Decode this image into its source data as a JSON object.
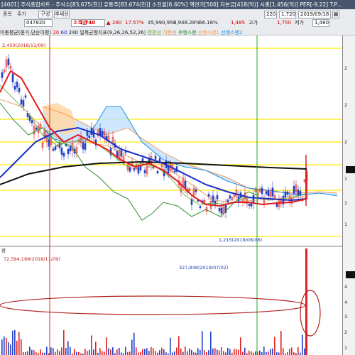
{
  "window": {
    "title": "[4001] 주식종합차트 - 주식수[83,675(천)] 유통주[83,674(천)] 소진율[6.60%] 액면가[500] 자본금[418(억)] 시총[1,456(억)] PER[-9.22] T.P..."
  },
  "toolbar": {
    "tabs": [
      "종목",
      "주기"
    ],
    "code_value": "047820",
    "buttons": [
      "구성",
      "추세선"
    ],
    "stock_name": "초록뱀",
    "price": "1,740",
    "price_arrow": "▲",
    "change": "260",
    "change_pct": "17.57%",
    "volume": "45,990,958",
    "amount": "3,948.28%",
    "ratio": "56.16%",
    "high_value": "1,485",
    "high_label": "고가",
    "prev_label": "저가",
    "prev_value": "1,750",
    "period_count": "220",
    "date_from": "1,720",
    "date_to": "2019/09/18",
    "qty": "1,480"
  },
  "legend": {
    "ma_label": "이동평균(종가,단순이평)",
    "ma_periods": [
      "20",
      "60",
      "240"
    ],
    "ichimoku_label": "일목균형지표(9,26,26,52,26)",
    "ichimoku_lines": [
      "전환선",
      "기준선",
      "후행스팬",
      "선행스팬1",
      "선행스팬2"
    ]
  },
  "annotations": {
    "price_high": "2,450(2018/11/09)",
    "price_low": "1,215(2019/08/06)",
    "volume_pane_label": "량",
    "volume_high": "72,594,198(2018/11/09)",
    "volume_mid": "327,848(2019/07/02)"
  },
  "axis": {
    "price_ticks": [
      "2",
      "2",
      "2",
      "1",
      "1",
      "1"
    ],
    "volume_ticks": [
      "4",
      "4",
      "3",
      "2",
      "1"
    ]
  },
  "colors": {
    "background": "#ffffff",
    "ma20": "#e41b1b",
    "ma60": "#1730c9",
    "ma240": "#111111",
    "conversion": "#55aa22",
    "base": "#d88a4a",
    "lagging": "#2f8f2f",
    "span1": "#ff9b55",
    "span2": "#1f8fe0",
    "up_candle": "#e0211f",
    "down_candle": "#2040c8",
    "guide_lines": "#ffee00"
  },
  "chart_data": {
    "type": "line",
    "series": [
      {
        "name": "20"
      },
      {
        "name": "60"
      },
      {
        "name": "240"
      },
      {
        "name": "전환선"
      },
      {
        "name": "기준선"
      },
      {
        "name": "후행스팬"
      },
      {
        "name": "선행스팬1"
      },
      {
        "name": "선행스팬2"
      }
    ],
    "price_range": [
      1215,
      2450
    ],
    "volume_range": [
      0,
      72594198
    ]
  }
}
